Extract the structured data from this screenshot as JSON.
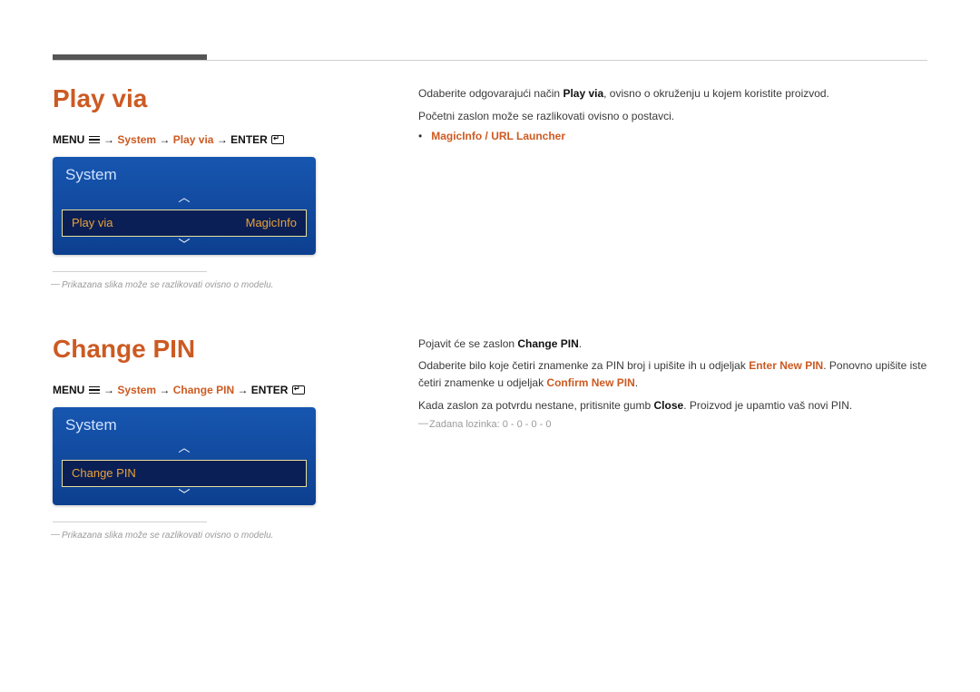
{
  "section1": {
    "title": "Play via",
    "breadcrumb": {
      "menu": "MENU",
      "arrow": "→",
      "system": "System",
      "playvia": "Play via",
      "enter": "ENTER"
    },
    "osd": {
      "title": "System",
      "row_label": "Play via",
      "row_value": "MagicInfo"
    },
    "footnote": "Prikazana slika može se razlikovati ovisno o modelu.",
    "right": {
      "line1_pre": "Odaberite odgovarajući način ",
      "line1_bold": "Play via",
      "line1_post": ", ovisno o okruženju u kojem koristite proizvod.",
      "line2": "Početni zaslon može se razlikovati ovisno o postavci.",
      "bullet": "MagicInfo / URL Launcher"
    }
  },
  "section2": {
    "title": "Change PIN",
    "breadcrumb": {
      "menu": "MENU",
      "arrow": "→",
      "system": "System",
      "changepin": "Change PIN",
      "enter": "ENTER"
    },
    "osd": {
      "title": "System",
      "row_label": "Change PIN"
    },
    "footnote": "Prikazana slika može se razlikovati ovisno o modelu.",
    "right": {
      "r1_pre": "Pojavit će se zaslon ",
      "r1_bold": "Change PIN",
      "r1_post": ".",
      "r2_pre": "Odaberite bilo koje četiri znamenke za PIN broj i upišite ih u odjeljak ",
      "r2_b1": "Enter New PIN",
      "r2_mid": ". Ponovno upišite iste četiri znamenke u odjeljak ",
      "r2_b2": "Confirm New PIN",
      "r2_post": ".",
      "r3_pre": "Kada zaslon za potvrdu nestane, pritisnite gumb ",
      "r3_bold": "Close",
      "r3_post": ". Proizvod je upamtio vaš novi PIN.",
      "note": "Zadana lozinka: 0 - 0 - 0 - 0"
    }
  }
}
